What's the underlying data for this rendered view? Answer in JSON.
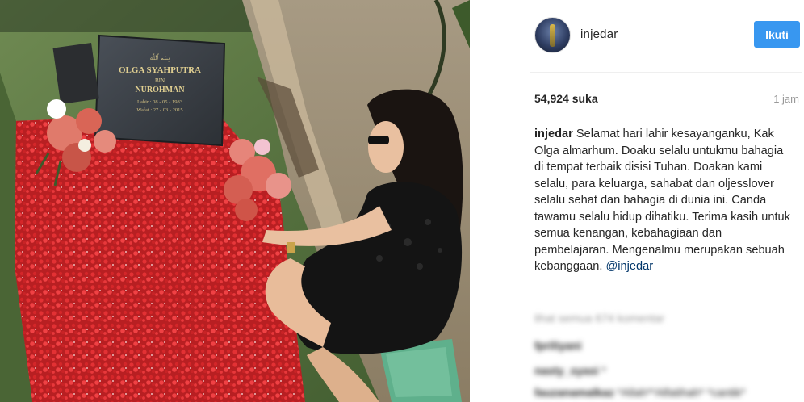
{
  "post": {
    "username": "injedar",
    "follow_label": "Ikuti",
    "likes": "54,924 suka",
    "time": "1 jam",
    "caption_user": "injedar",
    "caption_text": "Selamat hari lahir kesayanganku, Kak Olga almarhum. Doaku selalu untukmu bahagia di tempat terbaik disisi Tuhan. Doakan kami selalu, para keluarga, sahabat dan oljesslover selalu sehat dan bahagia di dunia ini. Canda tawamu selalu hidup dihatiku. Terima kasih untuk semua kenangan, kebahagiaan dan pembelajaran. Mengenalmu merupakan sebuah kebanggaan.",
    "caption_mention": "@injedar",
    "view_comments": "lihat semua 674 komentar",
    "comments": [
      {
        "user": "fpriliyani",
        "text": ""
      },
      {
        "user": "nasty_syasi",
        "text": "*"
      },
      {
        "user": "fauzanamalkaz",
        "text": "*Allah**Alfatihah* *cantik*"
      }
    ]
  },
  "photo": {
    "headstone_lines": [
      "OLGA SYAHPUTRA",
      "BIN",
      "NUROHMAN",
      "Lahir : 08 - 05 - 1983",
      "Wafat : 27 - 03 - 2015"
    ],
    "colors": {
      "grass": "#4f6b3c",
      "petals": "#d8262a",
      "stone": "#3a3f44",
      "dress": "#141414"
    }
  }
}
